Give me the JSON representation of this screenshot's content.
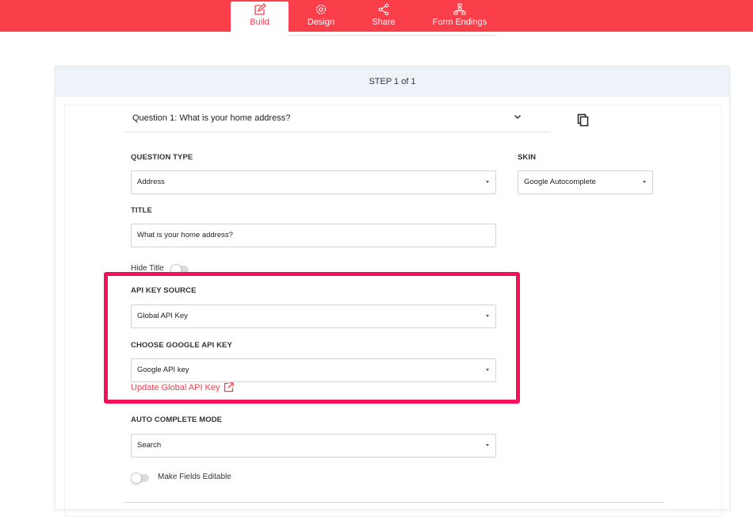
{
  "tabs": [
    {
      "label": "Build",
      "icon": "edit-icon",
      "active": true
    },
    {
      "label": "Design",
      "icon": "gear-icon",
      "active": false
    },
    {
      "label": "Share",
      "icon": "share-icon",
      "active": false
    },
    {
      "label": "Form Endings",
      "icon": "sitemap-icon",
      "active": false
    }
  ],
  "step": {
    "label": "STEP 1 of 1"
  },
  "question": {
    "title": "Question 1: What is your home address?"
  },
  "fields": {
    "question_type": {
      "label": "QUESTION TYPE",
      "value": "Address"
    },
    "skin": {
      "label": "SKIN",
      "value": "Google Autocomplete"
    },
    "title": {
      "label": "TITLE",
      "value": "What is your home address?"
    },
    "hide_title": {
      "label": "Hide Title",
      "on": false
    },
    "api_key_source": {
      "label": "API KEY SOURCE",
      "value": "Global API Key"
    },
    "google_api_key": {
      "label": "CHOOSE GOOGLE API KEY",
      "value": "Google API key"
    },
    "update_link": {
      "label": "Update Global API Key"
    },
    "auto_complete_mode": {
      "label": "AUTO COMPLETE MODE",
      "value": "Search"
    },
    "make_fields_editable": {
      "label": "Make Fields Editable",
      "on": false
    }
  },
  "colors": {
    "brand": "#fb3f4a",
    "highlight": "#f5105a",
    "step_header_bg": "#edf3f8"
  }
}
